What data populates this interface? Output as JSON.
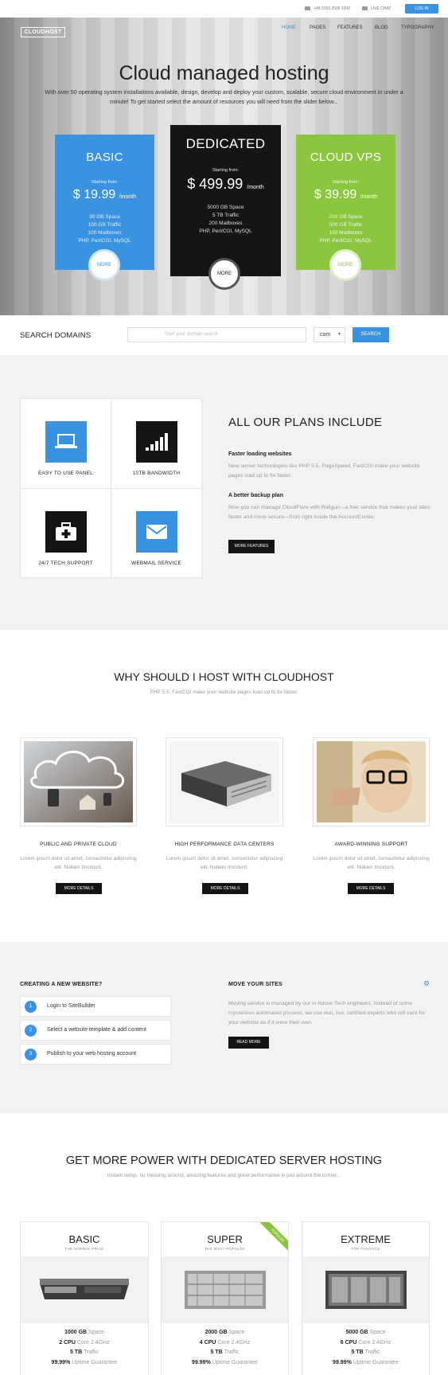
{
  "topbar": {
    "phone": "+48 0150 2506 0342",
    "live_chat": "LIVE CHAT",
    "login": "LOG IN"
  },
  "header": {
    "logo": "CLOUDHOST",
    "nav": [
      "HOME",
      "PAGES",
      "FEATURES",
      "BLOG",
      "TYPOGRAPHY"
    ],
    "active_color": "#3a93e0"
  },
  "hero": {
    "title": "Cloud managed hosting",
    "subtitle": "With over 50 operating system installations available, design, develop and deploy your custom, scalable, secure cloud environment in under a minute! To get started select the amount of resources you will need from the slider below...",
    "plans": [
      {
        "name": "BASIC",
        "starting": "Starting from:",
        "currency": "$",
        "price": "19.99",
        "period": "/month",
        "features": [
          "30 GB Space",
          "100 GB Traffic",
          "100 Mailboxes",
          "PHP, Perl/CGI, MySQL"
        ],
        "more": "MORE",
        "color": "#3a93e0"
      },
      {
        "name": "DEDICATED",
        "starting": "Starting from:",
        "currency": "$",
        "price": "499.99",
        "period": "/month",
        "features": [
          "5000 GB Space",
          "5 TB Traffic",
          "200 Mailboxes",
          "PHP, Perl/CGI, MySQL"
        ],
        "more": "MORE",
        "color": "#151515"
      },
      {
        "name": "CLOUD VPS",
        "starting": "Starting from:",
        "currency": "$",
        "price": "39.99",
        "period": "/month",
        "features": [
          "200 GB Space",
          "500 GB Traffic",
          "150 Mailboxes",
          "PHP, Perl/CGI, MySQL"
        ],
        "more": "MORE",
        "color": "#8cc63f"
      }
    ]
  },
  "search": {
    "title": "SEARCH DOMAINS",
    "placeholder": "Start your domain search",
    "tld": "com",
    "button": "SEARCH"
  },
  "features": {
    "boxes": [
      {
        "label": "EASY TO USE PANEL",
        "icon": "laptop-icon"
      },
      {
        "label": "10TB BANDWIDTH",
        "icon": "signal-bars-icon"
      },
      {
        "label": "24/7 TECH SUPPORT",
        "icon": "first-aid-kit-icon"
      },
      {
        "label": "WEBMAIL SERVICE",
        "icon": "envelope-icon"
      }
    ],
    "title": "ALL OUR PLANS INCLUDE",
    "items": [
      {
        "heading": "Faster loading websites",
        "text": "New server technologies like PHP 5.5, PageSpeed, FastCGI make your website pages load up to 6x faster."
      },
      {
        "heading": "A better backup plan",
        "text": "Now you can manage CloudFlare with Railgun—a free service that makes your sites faster and more secure—from right inside the AccountCenter."
      }
    ],
    "button": "MORE FEATURES"
  },
  "why": {
    "title": "WHY SHOULD I HOST WITH CLOUDHOST",
    "subtitle": "PHP 5.5, FastCGI make your website pages load up to 6x faster.",
    "cols": [
      {
        "caption": "PUBLIC AND PRIVATE CLOUD",
        "text": "Lorem ipsum dolor sit amet, consectetur adipiscing elit. Nullam tincidunt.",
        "button": "MORE DETAILS"
      },
      {
        "caption": "HIGH PERFORMANCE DATA CENTERS",
        "text": "Lorem ipsum dolor sit amet, consectetur adipiscing elit. Nullam tincidunt.",
        "button": "MORE DETAILS"
      },
      {
        "caption": "AWARD-WINNING SUPPORT",
        "text": "Lorem ipsum dolor sit amet, consectetur adipiscing elit. Nullam tincidunt.",
        "button": "MORE DETAILS"
      }
    ]
  },
  "steps": {
    "title": "CREATING A NEW WEBSITE?",
    "items": [
      {
        "num": "1",
        "label": "Login to SiteBuilder"
      },
      {
        "num": "2",
        "label": "Select a website template & add content"
      },
      {
        "num": "3",
        "label": "Publish to your web hosting account"
      }
    ]
  },
  "move": {
    "title": "MOVE YOUR SITES",
    "text": "Moving service is managed by our in-house Tech engineers. Instead of some mysterious automated process, we use real, live, certified experts who will care for your website as if it were their own.",
    "button": "READ MORE"
  },
  "dedicated": {
    "title": "GET MORE POWER WITH DEDICATED SERVER HOSTING",
    "subtitle": "Instant setup, no messing around, amazing features and great performance is just around the corner...",
    "cards": [
      {
        "name": "BASIC",
        "tag": "THE NORMAL PRICE",
        "specs": [
          [
            "1000 GB",
            " Space"
          ],
          [
            "2 CPU",
            " Core 2.4GHz"
          ],
          [
            "5 TB",
            " Traffic"
          ],
          [
            "99.99%",
            " Uptime Guarantee"
          ]
        ]
      },
      {
        "name": "SUPER",
        "tag": "THE MOST POPULAR",
        "ribbon": "POPULAR",
        "specs": [
          [
            "2000 GB",
            " Space"
          ],
          [
            "4 CPU",
            " Core 2.4GHz"
          ],
          [
            "5 TB",
            " Traffic"
          ],
          [
            "99.99%",
            " Uptime Guarantee"
          ]
        ]
      },
      {
        "name": "EXTREME",
        "tag": "FOR FANATICS",
        "specs": [
          [
            "5000 GB",
            " Space"
          ],
          [
            "6 CPU",
            " Core 2.4GHz"
          ],
          [
            "5 TB",
            " Traffic"
          ],
          [
            "99.99%",
            " Uptime Guarantee"
          ]
        ]
      }
    ]
  }
}
